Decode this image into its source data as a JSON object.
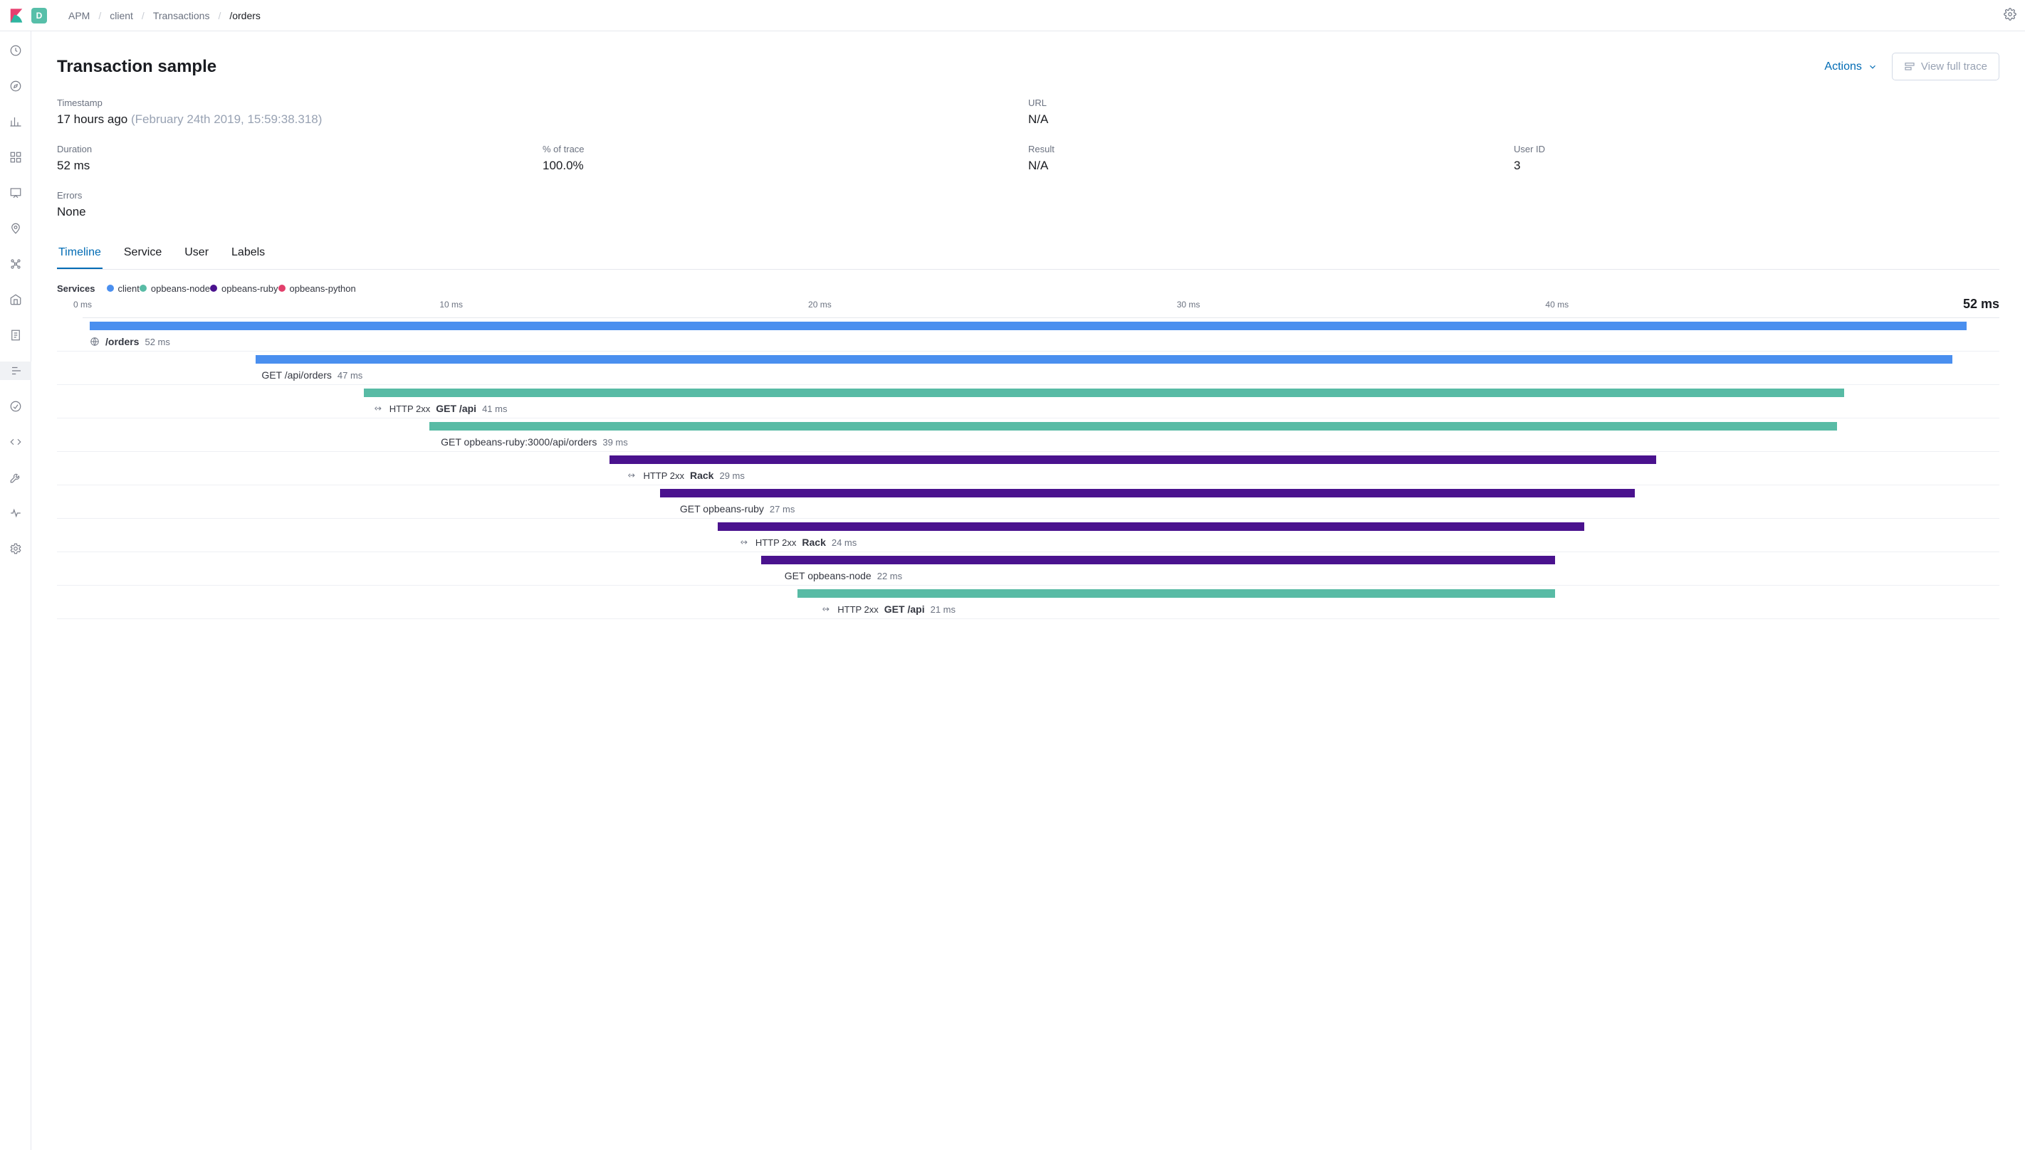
{
  "space_letter": "D",
  "breadcrumbs": [
    "APM",
    "client",
    "Transactions",
    "/orders"
  ],
  "page_title": "Transaction sample",
  "header_actions": {
    "actions_label": "Actions",
    "view_trace_label": "View full trace"
  },
  "summary": {
    "timestamp_label": "Timestamp",
    "timestamp_rel": "17 hours ago",
    "timestamp_abs": "(February 24th 2019, 15:59:38.318)",
    "url_label": "URL",
    "url_value": "N/A",
    "duration_label": "Duration",
    "duration_value": "52 ms",
    "pct_label": "% of trace",
    "pct_value": "100.0%",
    "result_label": "Result",
    "result_value": "N/A",
    "userid_label": "User ID",
    "userid_value": "3",
    "errors_label": "Errors",
    "errors_value": "None"
  },
  "tabs": [
    "Timeline",
    "Service",
    "User",
    "Labels"
  ],
  "active_tab": "Timeline",
  "services_label": "Services",
  "service_colors": {
    "client": "#4a8fef",
    "opbeans-node": "#58bba5",
    "opbeans-ruby": "#4a128e",
    "opbeans-python": "#e23f6b"
  },
  "services": [
    "client",
    "opbeans-node",
    "opbeans-ruby",
    "opbeans-python"
  ],
  "timeline": {
    "total_ms": 52,
    "total_label": "52 ms",
    "ticks": [
      0,
      10,
      20,
      30,
      40
    ]
  },
  "spans": [
    {
      "service": "client",
      "start": 0,
      "dur": 52,
      "icon": "globe",
      "bold_name": "/orders",
      "dur_label": "52 ms"
    },
    {
      "service": "client",
      "start": 4.6,
      "dur": 47,
      "name": "GET /api/orders",
      "dur_label": "47 ms"
    },
    {
      "service": "opbeans-node",
      "start": 7.6,
      "dur": 41,
      "icon": "ext",
      "http": "HTTP 2xx",
      "bold_name": "GET /api",
      "dur_label": "41 ms"
    },
    {
      "service": "opbeans-node",
      "start": 9.4,
      "dur": 39,
      "name": "GET opbeans-ruby:3000/api/orders",
      "dur_label": "39 ms"
    },
    {
      "service": "opbeans-ruby",
      "start": 14.4,
      "dur": 29,
      "icon": "ext",
      "http": "HTTP 2xx",
      "bold_name": "Rack",
      "dur_label": "29 ms"
    },
    {
      "service": "opbeans-ruby",
      "start": 15.8,
      "dur": 27,
      "name": "GET opbeans-ruby",
      "dur_label": "27 ms"
    },
    {
      "service": "opbeans-ruby",
      "start": 17.4,
      "dur": 24,
      "icon": "ext",
      "http": "HTTP 2xx",
      "bold_name": "Rack",
      "dur_label": "24 ms"
    },
    {
      "service": "opbeans-ruby",
      "start": 18.6,
      "dur": 22,
      "name": "GET opbeans-node",
      "dur_label": "22 ms"
    },
    {
      "service": "opbeans-node",
      "start": 19.6,
      "dur": 21,
      "icon": "ext",
      "http": "HTTP 2xx",
      "bold_name": "GET /api",
      "dur_label": "21 ms"
    }
  ]
}
